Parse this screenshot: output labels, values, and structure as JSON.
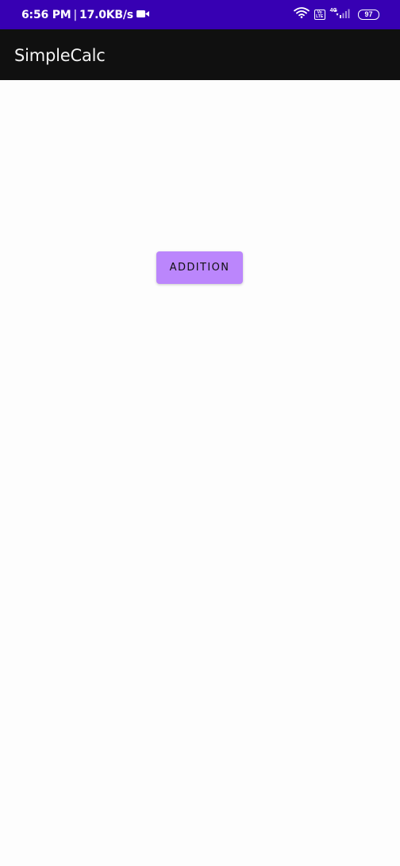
{
  "status_bar": {
    "time": "6:56 PM",
    "separator": "|",
    "net_speed": "17.0KB/s",
    "network_type": "4G",
    "volte_top": "Vo",
    "volte_bottom": "LTE",
    "battery_level": "97",
    "icons": [
      "video-camera-icon",
      "wifi-icon",
      "volte-icon",
      "signal-icon",
      "battery-icon"
    ],
    "background_color": "#3700b3"
  },
  "app_bar": {
    "title": "SimpleCalc",
    "background_color": "#101010"
  },
  "main": {
    "addition_button_label": "ADDITION",
    "button_color": "#bb86fc"
  }
}
